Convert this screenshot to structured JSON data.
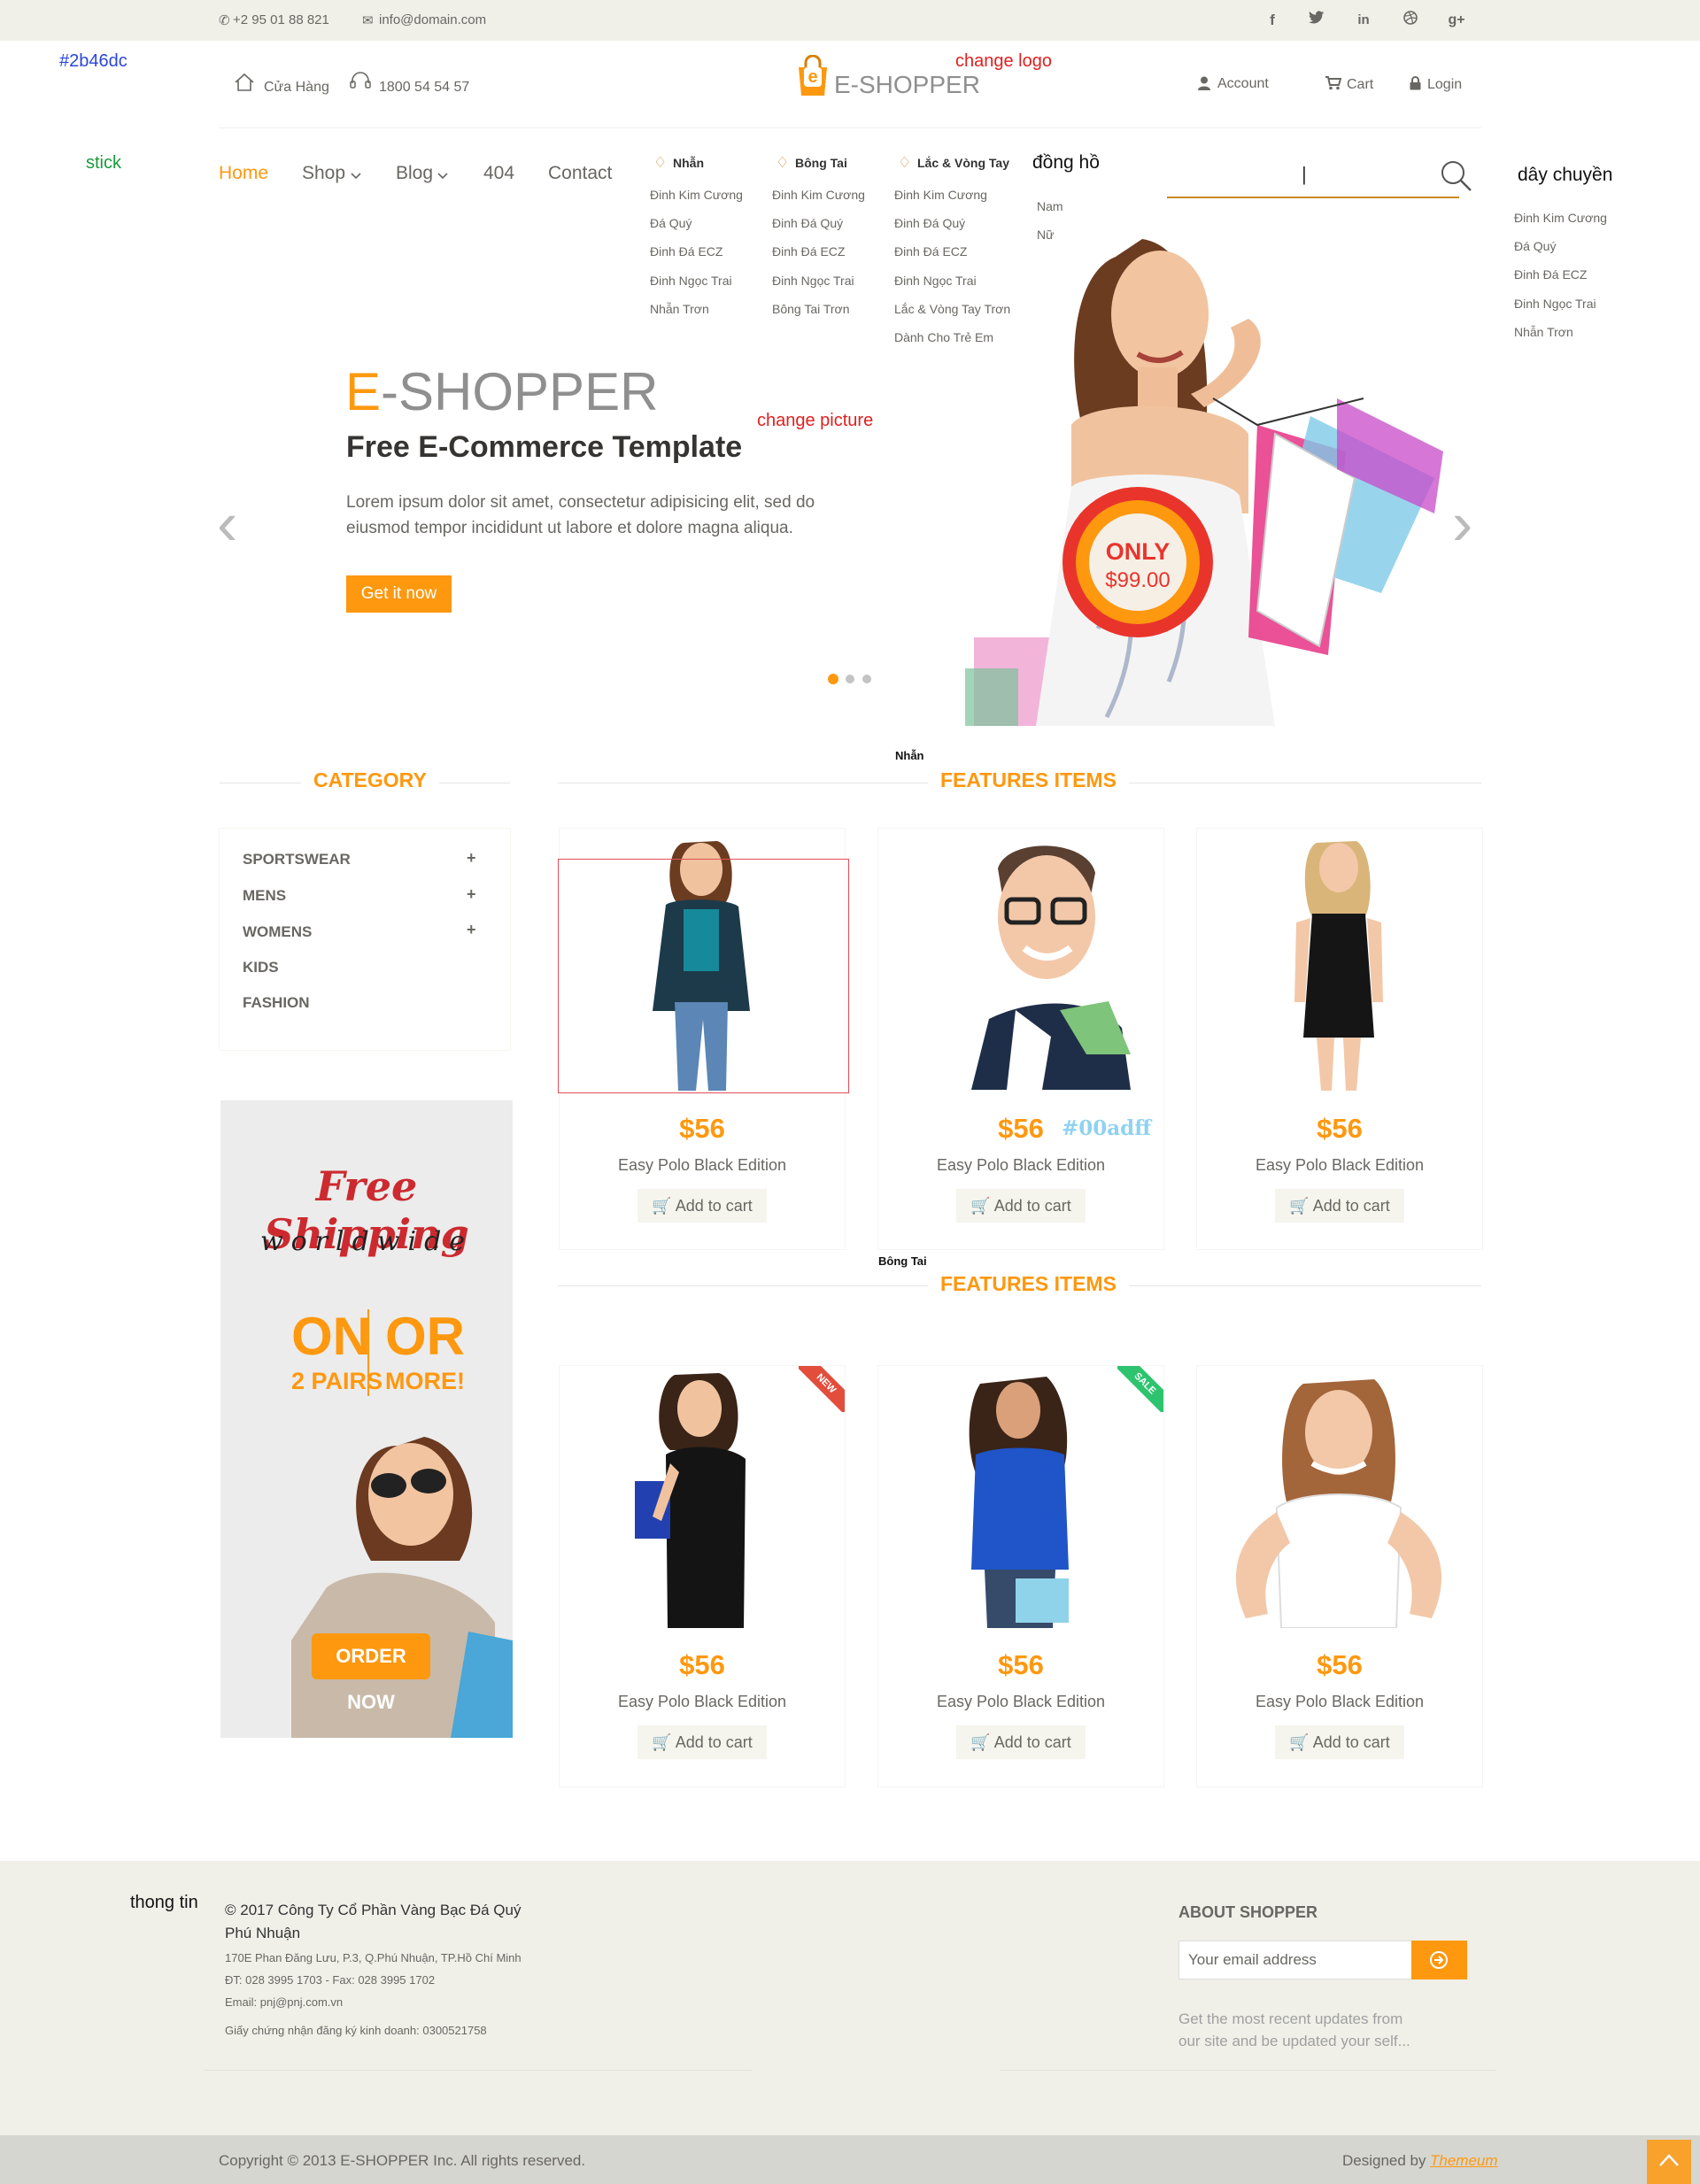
{
  "topbar": {
    "phone": "+2 95 01 88 821",
    "email": "info@domain.com",
    "social": [
      "facebook-icon",
      "twitter-icon",
      "linkedin-icon",
      "dribbble-icon",
      "google-plus-icon"
    ]
  },
  "header": {
    "store_label": "Cửa Hàng",
    "hotline": "1800 54 54 57",
    "logo_e": "e",
    "logo_text": "E-SHOPPER",
    "account": "Account",
    "cart": "Cart",
    "login": "Login"
  },
  "annotations": {
    "color_note": "#2b46dc",
    "stick": "stick",
    "change_logo": "change logo",
    "change_picture": "change picture",
    "mega_nhan": "Nhẫn",
    "mega_bongtai": "Bông Tai",
    "price_color": "#00adff",
    "thong_tin": "thong tin"
  },
  "nav": {
    "items": [
      "Home",
      "Shop",
      "Blog",
      "404",
      "Contact"
    ],
    "search_value": "|"
  },
  "mega_menu": {
    "columns": [
      {
        "title": "Nhẫn",
        "items": [
          "Đinh Kim Cương",
          "Đá Quý",
          "Đinh Đá ECZ",
          "Đinh Ngọc Trai",
          "Nhẫn Trơn"
        ]
      },
      {
        "title": "Bông Tai",
        "items": [
          "Đinh Kim Cương",
          "Đinh Đá Quý",
          "Đinh Đá ECZ",
          "Đinh Ngọc Trai",
          "Bông Tai Trơn"
        ]
      },
      {
        "title": "Lắc & Vòng Tay",
        "items": [
          "Đinh Kim Cương",
          "Đinh Đá Quý",
          "Đinh Đá ECZ",
          "Đinh Ngọc Trai",
          "Lắc & Vòng Tay Trơn",
          "Dành Cho Trẻ Em"
        ]
      },
      {
        "title": "đồng hồ",
        "items": [
          "Nam",
          "Nữ"
        ]
      },
      {
        "title": "dây chuyền",
        "items": [
          "Đinh Kim Cương",
          "Đá Quý",
          "Đinh Đá ECZ",
          "Đinh Ngọc Trai",
          "Nhẫn Trơn"
        ]
      }
    ]
  },
  "slider": {
    "brand_e": "E",
    "brand_rest": "-SHOPPER",
    "headline": "Free E-Commerce Template",
    "body": "Lorem ipsum dolor sit amet, consectetur adipisicing elit, sed do eiusmod tempor incididunt ut labore et dolore magna aliqua.",
    "cta": "Get it now",
    "badge_top": "ONLY",
    "badge_price": "$99.00",
    "dots": 3,
    "active_dot": 1
  },
  "category": {
    "title": "CATEGORY",
    "items": [
      {
        "label": "SPORTSWEAR",
        "expandable": true
      },
      {
        "label": "MENS",
        "expandable": true
      },
      {
        "label": "WOMENS",
        "expandable": true
      },
      {
        "label": "KIDS",
        "expandable": false
      },
      {
        "label": "FASHION",
        "expandable": false
      }
    ]
  },
  "banner": {
    "line1": "Free Shipping",
    "line2": "worldwide",
    "on": "ON",
    "pairs": "2 PAIRS",
    "or": "OR",
    "more": "MORE!",
    "order": "ORDER NOW"
  },
  "features": [
    {
      "title": "FEATURES ITEMS",
      "products": [
        {
          "price": "$56",
          "name": "Easy Polo Black Edition",
          "button": "Add to cart"
        },
        {
          "price": "$56",
          "name": "Easy Polo Black Edition",
          "button": "Add to cart"
        },
        {
          "price": "$56",
          "name": "Easy Polo Black Edition",
          "button": "Add to cart"
        }
      ]
    },
    {
      "title": "FEATURES ITEMS",
      "products": [
        {
          "price": "$56",
          "name": "Easy Polo Black Edition",
          "button": "Add to cart",
          "ribbon": "NEW"
        },
        {
          "price": "$56",
          "name": "Easy Polo Black Edition",
          "button": "Add to cart",
          "ribbon": "SALE"
        },
        {
          "price": "$56",
          "name": "Easy Polo Black Edition",
          "button": "Add to cart"
        }
      ]
    }
  ],
  "footer": {
    "company_line1": "© 2017 Công Ty Cổ Phần Vàng Bạc Đá Quý",
    "company_line2": "Phú Nhuận",
    "address": "170E Phan Đăng Lưu, P.3, Q.Phú Nhuận, TP.Hồ Chí Minh",
    "phone": "ĐT: 028 3995 1703 - Fax: 028 3995 1702",
    "email": "Email: pnj@pnj.com.vn",
    "license": "Giấy chứng nhận đăng ký kinh doanh: 0300521758",
    "about_title": "ABOUT SHOPPER",
    "email_placeholder": "Your email address",
    "about_text": "Get the most recent updates from our site and be updated your self...",
    "copyright": "Copyright © 2013 E-SHOPPER Inc. All rights reserved.",
    "designed_by": "Designed by",
    "designer": "Themeum"
  },
  "colors": {
    "accent": "#fe980f",
    "text": "#696763",
    "footer_bg": "#f0f0e9",
    "annot_blue": "#2b46dc",
    "annot_green": "#1a9a3a",
    "annot_red": "#e0201f"
  }
}
